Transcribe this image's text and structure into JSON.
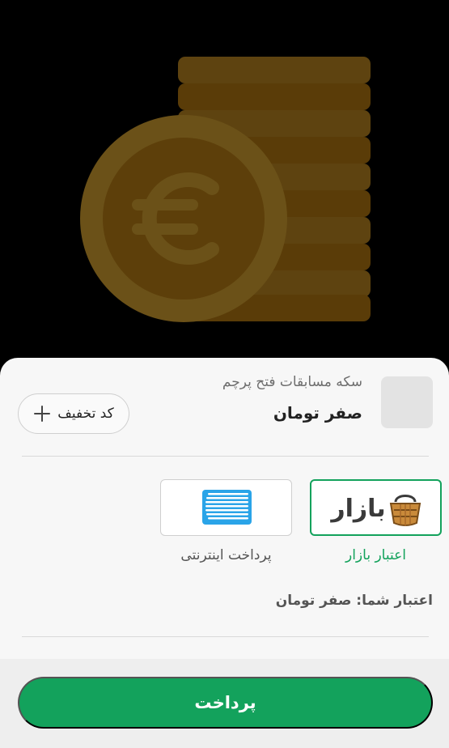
{
  "product": {
    "name": "سکه مسابقات فتح پرچم",
    "price": "صفر تومان"
  },
  "discount": {
    "label": "کد تخفیف"
  },
  "payment_options": [
    {
      "label": "اعتبار بازار",
      "logo_text": "بازار",
      "selected": true,
      "color": "#13a25c"
    },
    {
      "label": "پرداخت اینترنتی",
      "selected": false
    }
  ],
  "credit": {
    "text": "اعتبار شما: صفر تومان"
  },
  "action": {
    "pay_label": "پرداخت"
  },
  "colors": {
    "accent": "#13a25c",
    "coin": "#6e4d0f"
  }
}
